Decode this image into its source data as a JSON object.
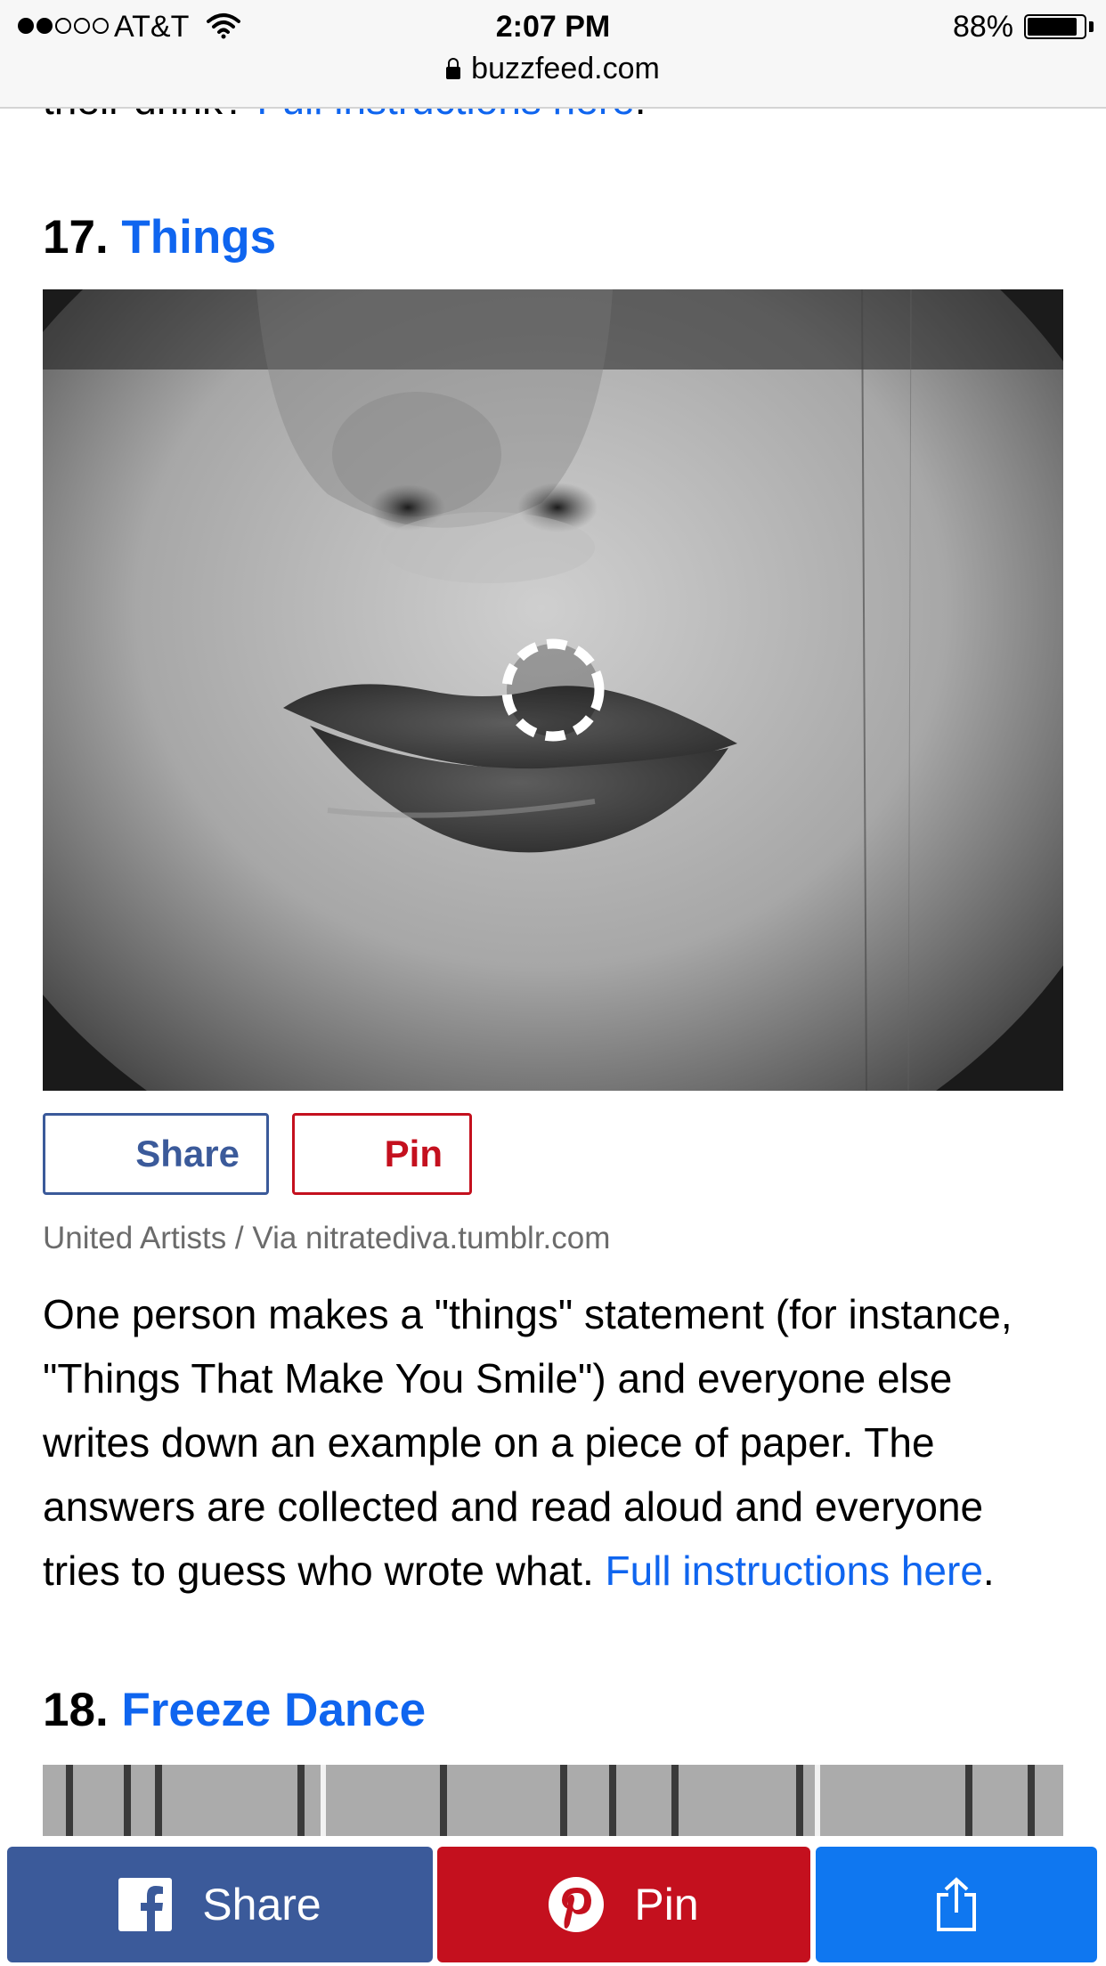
{
  "status_bar": {
    "signal_total": 5,
    "signal_filled": 2,
    "carrier": "AT&T",
    "time": "2:07 PM",
    "battery_percent": "88%",
    "battery_level": 0.88,
    "url": "buzzfeed.com"
  },
  "article": {
    "prev_partial_text": "their drink? ",
    "prev_link": "Full instructions here",
    "prev_end": ".",
    "item17": {
      "number": "17.",
      "title": "Things",
      "share_label": "Share",
      "pin_label": "Pin",
      "credit": "United Artists / Via nitratediva.tumblr.com",
      "body_lines": [
        "One person makes a \"things\" statement (for instance,",
        "\"Things That Make You Smile\") and everyone else",
        "writes down an example on a piece of paper. The",
        "answers are collected and read aloud and everyone"
      ],
      "last_line": "tries to guess who wrote what. ",
      "link": "Full instructions here",
      "end": "."
    },
    "item18": {
      "number": "18.",
      "title": "Freeze Dance"
    }
  },
  "share_bar": {
    "facebook_label": "Share",
    "pinterest_label": "Pin"
  },
  "icons": [
    "wifi-icon",
    "lock-icon",
    "battery-icon",
    "loading-spinner-icon",
    "facebook-icon",
    "pinterest-icon",
    "share-out-icon"
  ],
  "colors": {
    "link": "#0f65ef",
    "facebook": "#3b5a9a",
    "pinterest": "#c4101e",
    "share_more": "#0f77f0"
  }
}
